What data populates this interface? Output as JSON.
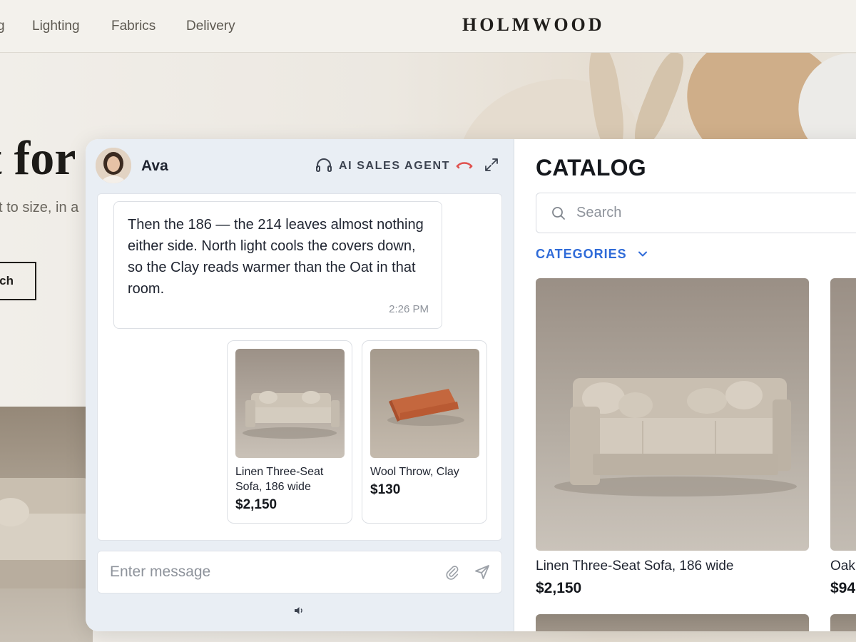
{
  "site": {
    "brand": "HOLMWOOD",
    "nav": [
      "g",
      "Lighting",
      "Fabrics",
      "Delivery"
    ],
    "hero_title": "t for",
    "hero_subtitle": "t to size, in a",
    "hero_button": "ch"
  },
  "chat": {
    "agent_name": "Ava",
    "agent_role": "AI SALES AGENT",
    "message": {
      "text": "Then the 186 — the 214 leaves almost nothing either side. North light cools the covers down, so the Clay reads warmer than the Oat in that room.",
      "time": "2:26 PM"
    },
    "products": [
      {
        "name": "Linen Three-Seat Sofa, 186 wide",
        "price": "$2,150",
        "icon": "sofa-image"
      },
      {
        "name": "Wool Throw, Clay",
        "price": "$130",
        "icon": "throw-image"
      }
    ],
    "composer_placeholder": "Enter message"
  },
  "catalog": {
    "title": "CATALOG",
    "search_placeholder": "Search",
    "categories_label": "CATEGORIES",
    "items": [
      {
        "name": "Linen Three-Seat Sofa, 186 wide",
        "price": "$2,150"
      },
      {
        "name": "Oak",
        "price": "$94"
      }
    ]
  },
  "colors": {
    "accent": "#2f6bd8",
    "hangup": "#e0524f",
    "chat_bg": "#e9eef4"
  }
}
